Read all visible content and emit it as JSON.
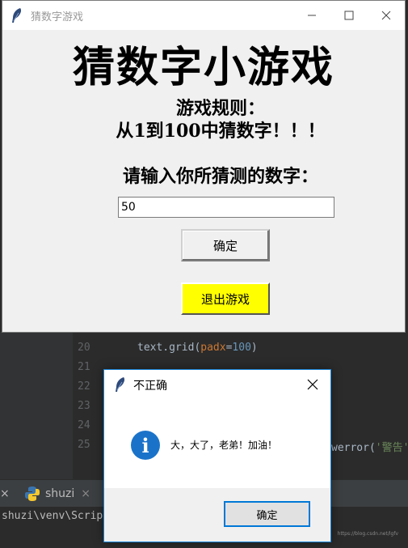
{
  "ide": {
    "line_numbers": [
      "20",
      "21",
      "22",
      "23",
      "24",
      "25"
    ],
    "line20_code": "text.grid(",
    "line20_kwarg": "padx",
    "line20_eq": "=",
    "line20_num": "100",
    "line20_close": ")",
    "line25_tail": "werror(",
    "line25_str": "'警告'",
    "tab_label": "shuzi",
    "terminal_path": "shuzi\\venv\\Scrip",
    "watermark": "https://blog.csdn.net/lgfv"
  },
  "main_window": {
    "title": "猜数字游戏",
    "heading": "猜数字小游戏",
    "rules_line1": "游戏规则：",
    "rules_line2": "从1到100中猜数字！！！",
    "prompt": "请输入你所猜测的数字：",
    "entry_value": "50",
    "confirm_label": "确定",
    "exit_label": "退出游戏"
  },
  "dialog": {
    "title": "不正确",
    "message": "大，大了，老弟！加油！",
    "ok_label": "确定"
  },
  "colors": {
    "exit_button": "#ffff00",
    "info_icon": "#1a73c9",
    "dialog_border": "#0078d7"
  }
}
